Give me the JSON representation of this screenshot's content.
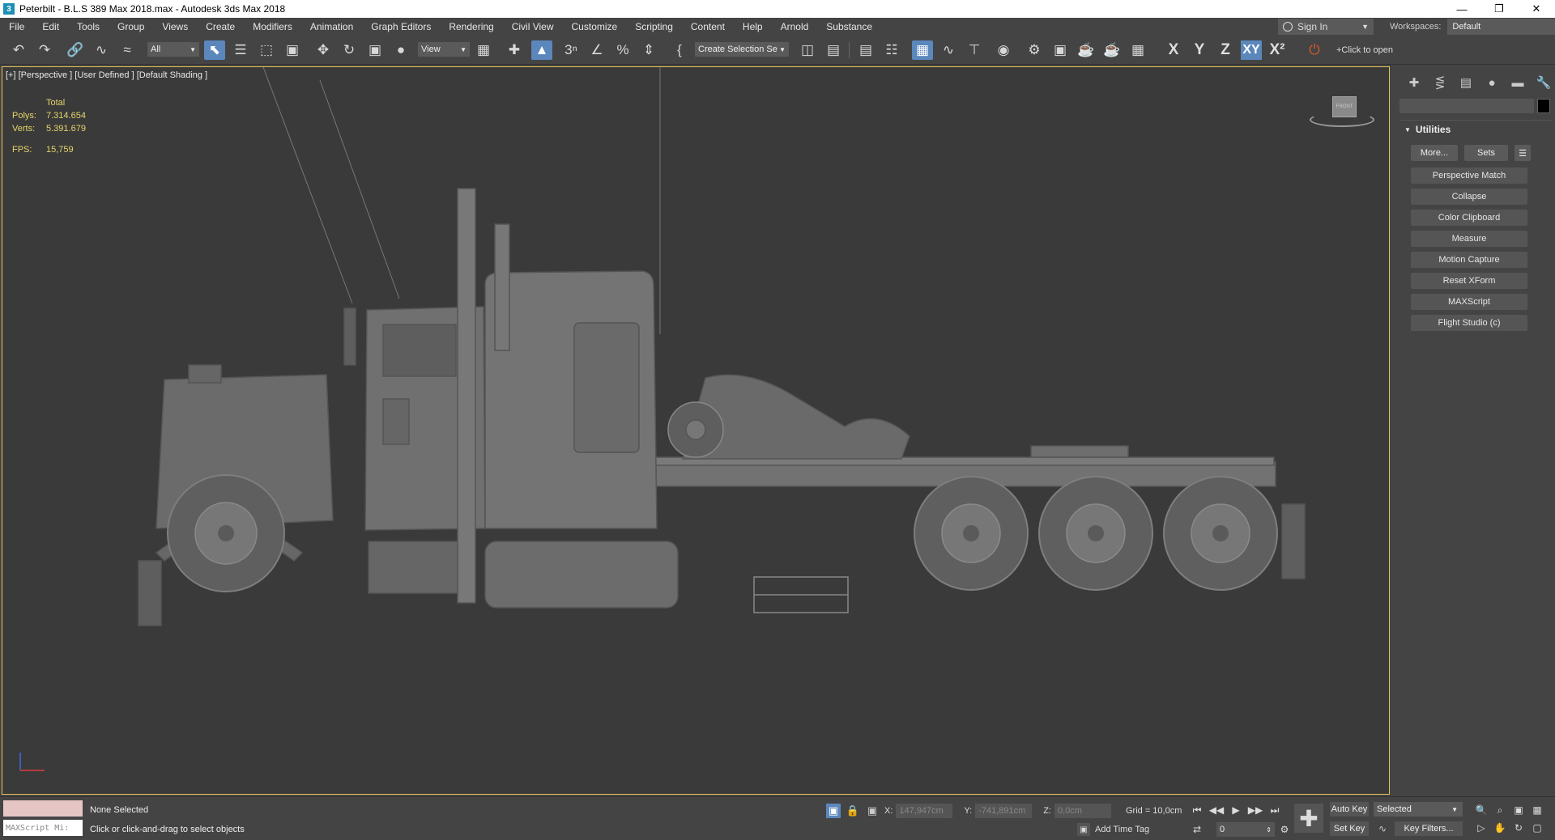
{
  "titlebar": {
    "title": "Peterbilt - B.L.S 389 Max 2018.max - Autodesk 3ds Max 2018",
    "app_icon": "3ds-max-icon"
  },
  "menu": [
    "File",
    "Edit",
    "Tools",
    "Group",
    "Views",
    "Create",
    "Modifiers",
    "Animation",
    "Graph Editors",
    "Rendering",
    "Civil View",
    "Customize",
    "Scripting",
    "Content",
    "Help",
    "Arnold",
    "Substance"
  ],
  "account": {
    "sign_in": "Sign In",
    "workspaces_label": "Workspaces:",
    "workspace": "Default"
  },
  "toolbar": {
    "filter": "All",
    "ref_coord": "View",
    "selection_set": "Create Selection Se",
    "axis_x": "X",
    "axis_y": "Y",
    "axis_z": "Z",
    "axis_xy": "XY",
    "axis_x2": "X²",
    "click_to_open": "+Click to open"
  },
  "viewport": {
    "label": "[+] [Perspective ] [User Defined ] [Default Shading ]",
    "stats": {
      "header": "Total",
      "polys_label": "Polys:",
      "polys": "7.314.654",
      "verts_label": "Verts:",
      "verts": "5.391.679",
      "fps_label": "FPS:",
      "fps": "15,759"
    },
    "viewcube_label": "FRONT"
  },
  "command_panel": {
    "rollout_title": "Utilities",
    "more_button": "More...",
    "sets_button": "Sets",
    "utilities": [
      "Perspective Match",
      "Collapse",
      "Color Clipboard",
      "Measure",
      "Motion Capture",
      "Reset XForm",
      "MAXScript",
      "Flight Studio (c)"
    ]
  },
  "status": {
    "maxscript_placeholder": "MAXScript Mi:",
    "selection": "None Selected",
    "prompt": "Click or click-and-drag to select objects",
    "x_label": "X:",
    "x": "147,947cm",
    "y_label": "Y:",
    "y": "-741,891cm",
    "z_label": "Z:",
    "z": "0,0cm",
    "grid": "Grid = 10,0cm",
    "add_time_tag": "Add Time Tag",
    "frame": "0",
    "auto_key": "Auto Key",
    "set_key": "Set Key",
    "selected": "Selected",
    "key_filters": "Key Filters..."
  }
}
